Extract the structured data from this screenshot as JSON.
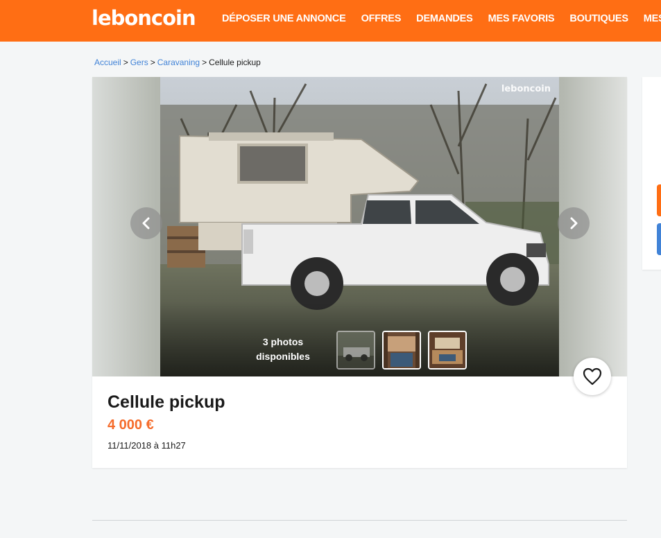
{
  "brand": {
    "logo": "leboncoin",
    "color": "#ff6e14"
  },
  "nav": [
    "DÉPOSER UNE ANNONCE",
    "OFFRES",
    "DEMANDES",
    "MES FAVORIS",
    "BOUTIQUES",
    "MESSAGES"
  ],
  "breadcrumb": {
    "items": [
      "Accueil",
      "Gers",
      "Caravaning"
    ],
    "current": "Cellule pickup",
    "separator": ">"
  },
  "gallery": {
    "watermark": "leboncoin",
    "photo_count": "3 photos disponibles",
    "prev_icon": "chevron-left-icon",
    "next_icon": "chevron-right-icon"
  },
  "listing": {
    "title": "Cellule pickup",
    "price": "4 000 €",
    "date": "11/11/2018 à 11h27",
    "price_color": "#f56b2a"
  },
  "favorite": {
    "icon": "heart-icon"
  }
}
